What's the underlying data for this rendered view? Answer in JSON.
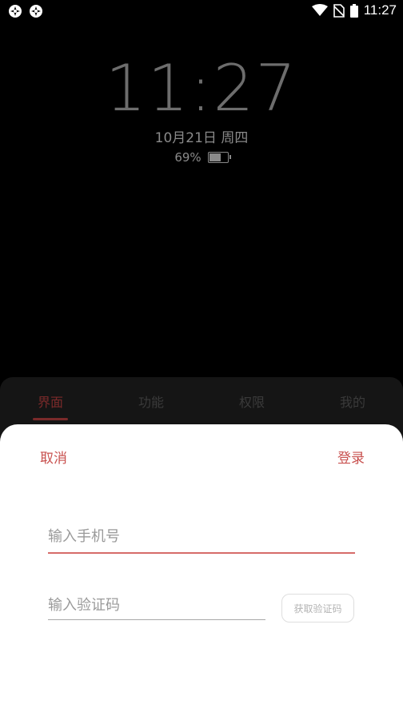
{
  "status_bar": {
    "time": "11:27",
    "icons": [
      "app-notification-icon",
      "app-notification-icon",
      "wifi-icon",
      "no-sim-icon",
      "battery-icon"
    ]
  },
  "lock_screen": {
    "clock": "11:27",
    "date": "10月21日 周四",
    "battery_percent": "69%",
    "battery_level": 0.69
  },
  "tabs": [
    {
      "label": "界面",
      "active": true
    },
    {
      "label": "功能",
      "active": false
    },
    {
      "label": "权限",
      "active": false
    },
    {
      "label": "我的",
      "active": false
    }
  ],
  "sheet": {
    "cancel_label": "取消",
    "login_label": "登录",
    "phone_placeholder": "输入手机号",
    "code_placeholder": "输入验证码",
    "get_code_label": "获取验证码"
  },
  "colors": {
    "accent": "#c8504e",
    "background": "#000000",
    "sheet": "#ffffff"
  }
}
